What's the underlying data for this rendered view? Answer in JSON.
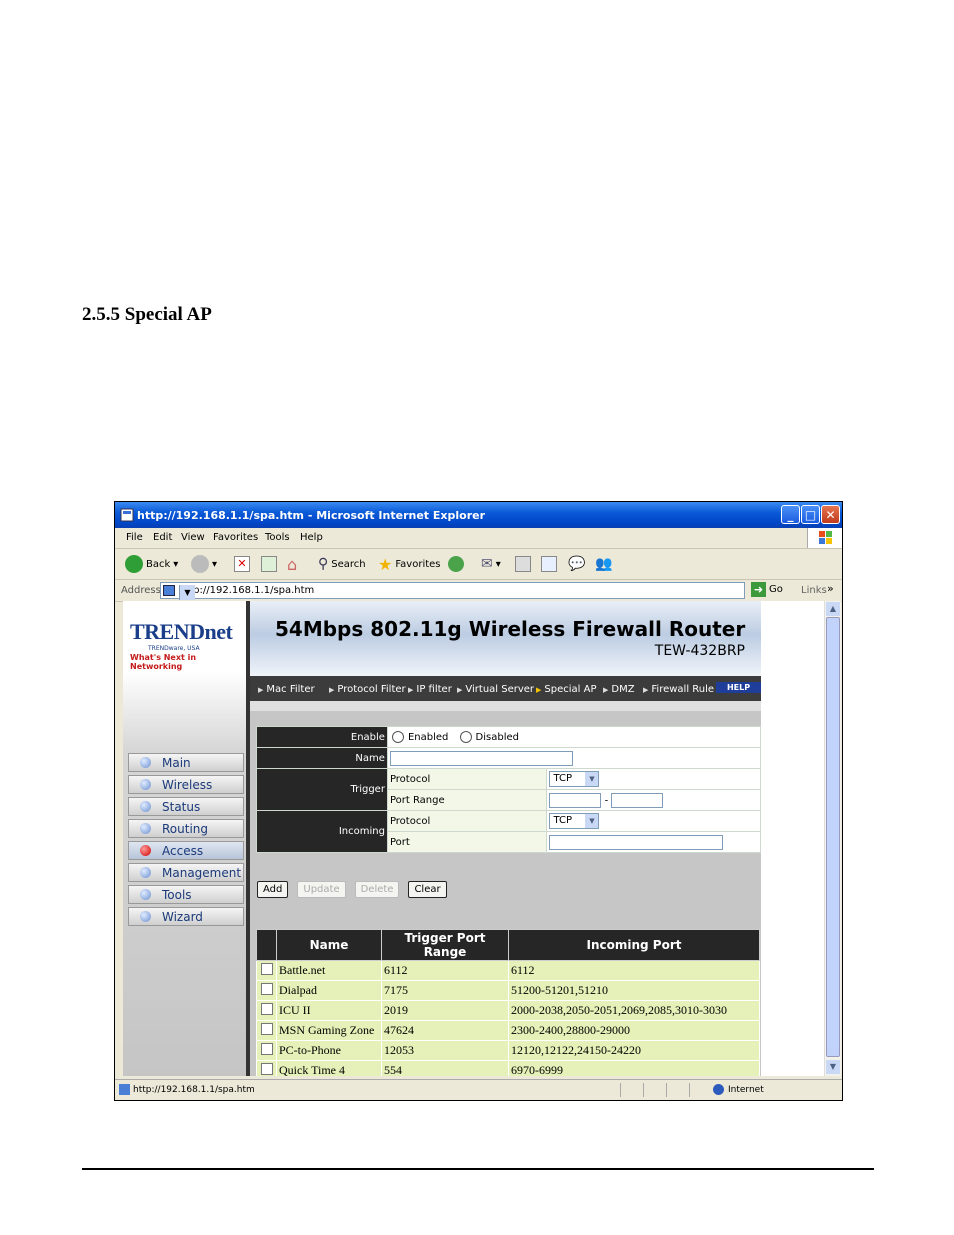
{
  "document": {
    "heading": "2.5.5  Special AP"
  },
  "window": {
    "title": "http://192.168.1.1/spa.htm - Microsoft Internet Explorer",
    "menu": [
      "File",
      "Edit",
      "View",
      "Favorites",
      "Tools",
      "Help"
    ],
    "toolbar": {
      "back": "Back",
      "search": "Search",
      "favorites": "Favorites"
    },
    "address_label": "Address",
    "address_value": "http://192.168.1.1/spa.htm",
    "go": "Go",
    "links": "Links",
    "status_text": "http://192.168.1.1/spa.htm",
    "status_zone": "Internet"
  },
  "router": {
    "logo_brand": "TRENDnet",
    "logo_sub": "TRENDware, USA",
    "logo_tagline": "What's Next in Networking",
    "banner_title": "54Mbps 802.11g Wireless Firewall Router",
    "banner_model": "TEW-432BRP",
    "nav": [
      "Main",
      "Wireless",
      "Status",
      "Routing",
      "Access",
      "Management",
      "Tools",
      "Wizard"
    ],
    "nav_active": "Access",
    "tabs": [
      "Mac Filter",
      "Protocol Filter",
      "IP filter",
      "Virtual Server",
      "Special AP",
      "DMZ",
      "Firewall Rule"
    ],
    "tab_active": "Special AP",
    "help": "HELP"
  },
  "form": {
    "enable_label": "Enable",
    "enabled_option": "Enabled",
    "disabled_option": "Disabled",
    "name_label": "Name",
    "trigger_label": "Trigger",
    "incoming_label": "Incoming",
    "protocol_label": "Protocol",
    "port_range_label": "Port Range",
    "port_label": "Port",
    "trigger_protocol": "TCP",
    "incoming_protocol": "TCP",
    "range_sep": "-",
    "buttons": {
      "add": "Add",
      "update": "Update",
      "delete": "Delete",
      "clear": "Clear"
    }
  },
  "list": {
    "headers": [
      "Name",
      "Trigger Port Range",
      "Incoming Port"
    ],
    "rows": [
      [
        "Battle.net",
        "6112",
        "6112"
      ],
      [
        "Dialpad",
        "7175",
        "51200-51201,51210"
      ],
      [
        "ICU II",
        "2019",
        "2000-2038,2050-2051,2069,2085,3010-3030"
      ],
      [
        "MSN Gaming Zone",
        "47624",
        "2300-2400,28800-29000"
      ],
      [
        "PC-to-Phone",
        "12053",
        "12120,12122,24150-24220"
      ],
      [
        "Quick Time 4",
        "554",
        "6970-6999"
      ]
    ]
  }
}
